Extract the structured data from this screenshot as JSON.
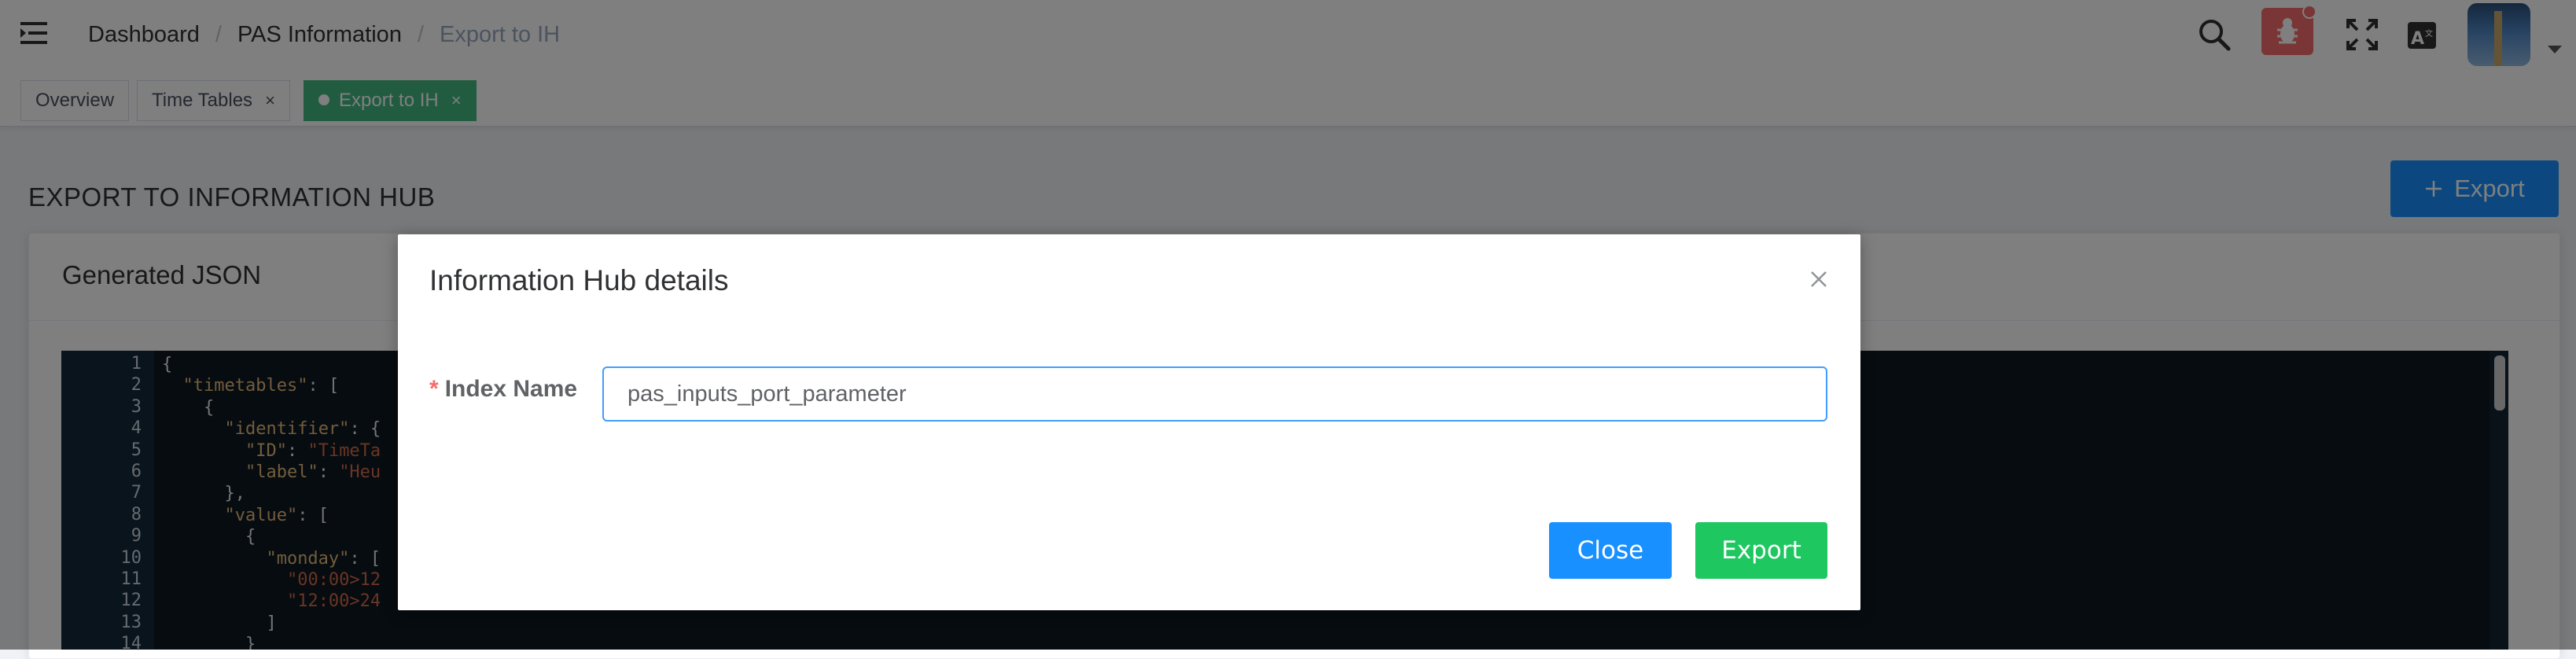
{
  "header": {
    "breadcrumb": [
      "Dashboard",
      "PAS Information",
      "Export to IH"
    ],
    "icons": [
      "hamburger-icon",
      "search-icon",
      "bug-icon",
      "fullscreen-icon",
      "translate-icon",
      "avatar",
      "caret-down-icon"
    ]
  },
  "tags": [
    {
      "label": "Overview",
      "closable": false,
      "active": false
    },
    {
      "label": "Time Tables",
      "closable": true,
      "active": false
    },
    {
      "label": "Export to IH",
      "closable": true,
      "active": true
    }
  ],
  "tag_close_glyph": "×",
  "page": {
    "title": "EXPORT TO INFORMATION HUB",
    "export_button": "Export",
    "card_title": "Generated JSON"
  },
  "editor": {
    "lines": [
      {
        "n": "1",
        "text": "{"
      },
      {
        "n": "2",
        "text": "  \"timetables\": ["
      },
      {
        "n": "3",
        "text": "    {"
      },
      {
        "n": "4",
        "text": "      \"identifier\": {"
      },
      {
        "n": "5",
        "text": "        \"ID\": \"TimeTa"
      },
      {
        "n": "6",
        "text": "        \"label\": \"Heu"
      },
      {
        "n": "7",
        "text": "      },"
      },
      {
        "n": "8",
        "text": "      \"value\": ["
      },
      {
        "n": "9",
        "text": "        {"
      },
      {
        "n": "10",
        "text": "          \"monday\": ["
      },
      {
        "n": "11",
        "text": "            \"00:00>12"
      },
      {
        "n": "12",
        "text": "            \"12:00>24"
      },
      {
        "n": "13",
        "text": "          ]"
      },
      {
        "n": "14",
        "text": "        }"
      }
    ]
  },
  "dialog": {
    "title": "Information Hub details",
    "label_required_mark": "*",
    "label": "Index Name",
    "input_value": "pas_inputs_port_parameter",
    "close_button": "Close",
    "export_button": "Export"
  },
  "colors": {
    "primary": "#1890ff",
    "success": "#1ec760",
    "active_tag": "#42b983",
    "bug_button": "#f56c6c",
    "editor_bg": "#0c1821"
  }
}
